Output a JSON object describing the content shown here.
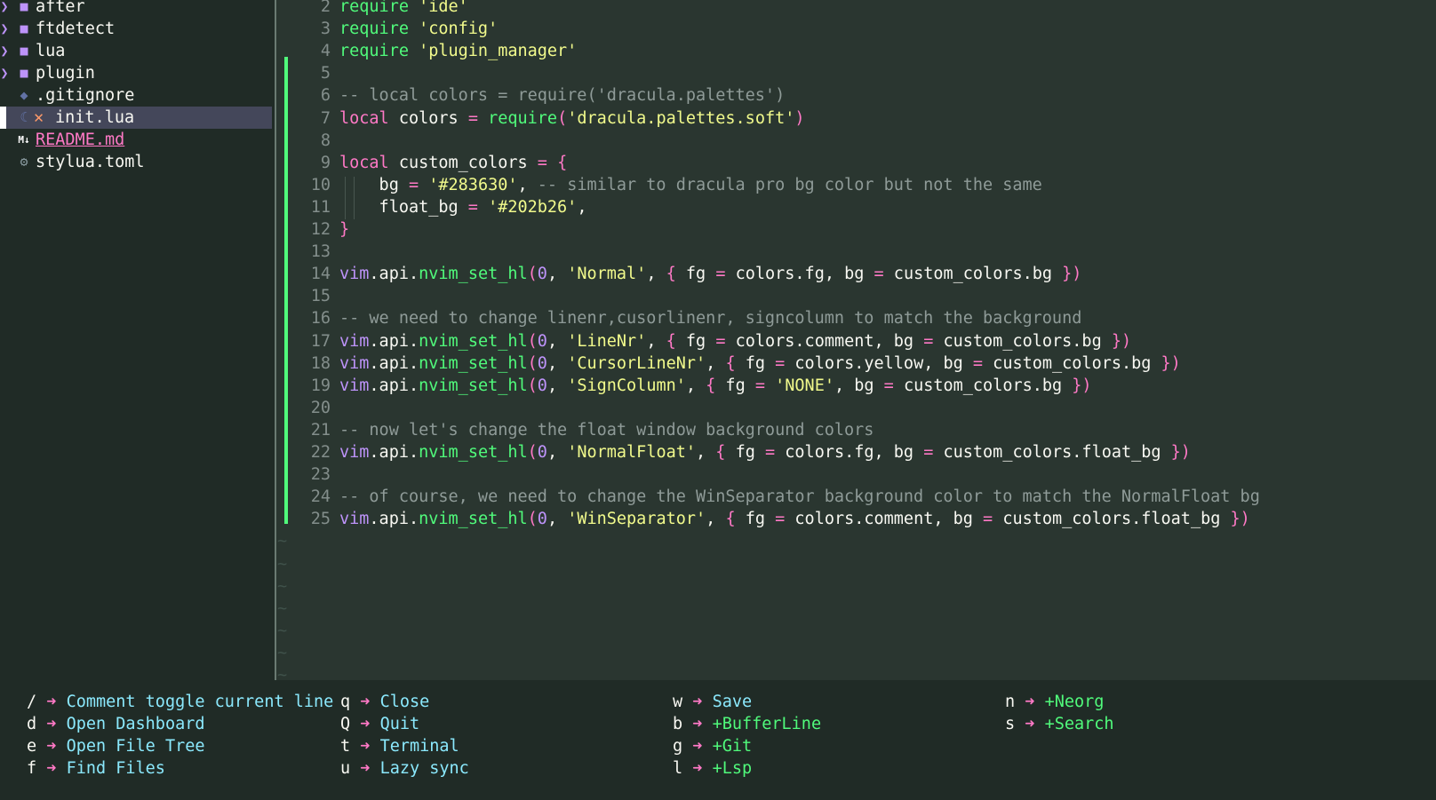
{
  "file_tree": {
    "items": [
      {
        "name": "after",
        "type": "folder",
        "expanded": false
      },
      {
        "name": "ftdetect",
        "type": "folder",
        "expanded": false
      },
      {
        "name": "lua",
        "type": "folder",
        "expanded": false
      },
      {
        "name": "plugin",
        "type": "folder",
        "expanded": false
      },
      {
        "name": ".gitignore",
        "type": "file",
        "icon": "git-icon"
      },
      {
        "name": "init.lua",
        "type": "file",
        "icon": "lua-icon",
        "active": true,
        "modified_mark": "✕"
      },
      {
        "name": "README.md",
        "type": "file",
        "icon": "markdown-icon"
      },
      {
        "name": "stylua.toml",
        "type": "file",
        "icon": "gear-icon"
      }
    ]
  },
  "editor": {
    "lines": [
      {
        "n": "2",
        "tokens": [
          [
            "fn",
            "require"
          ],
          [
            "id",
            " "
          ],
          [
            "str",
            "'ide'"
          ]
        ]
      },
      {
        "n": "3",
        "tokens": [
          [
            "fn",
            "require"
          ],
          [
            "id",
            " "
          ],
          [
            "str",
            "'config'"
          ]
        ]
      },
      {
        "n": "4",
        "tokens": [
          [
            "fn",
            "require"
          ],
          [
            "id",
            " "
          ],
          [
            "str",
            "'plugin_manager'"
          ]
        ]
      },
      {
        "n": "5",
        "tokens": []
      },
      {
        "n": "6",
        "tokens": [
          [
            "cm",
            "-- local colors = require('dracula.palettes')"
          ]
        ]
      },
      {
        "n": "7",
        "tokens": [
          [
            "kw",
            "local"
          ],
          [
            "id",
            " colors "
          ],
          [
            "kw",
            "="
          ],
          [
            "id",
            " "
          ],
          [
            "fn",
            "require"
          ],
          [
            "br",
            "("
          ],
          [
            "str",
            "'dracula.palettes.soft'"
          ],
          [
            "br",
            ")"
          ]
        ]
      },
      {
        "n": "8",
        "tokens": []
      },
      {
        "n": "9",
        "tokens": [
          [
            "kw",
            "local"
          ],
          [
            "id",
            " custom_colors "
          ],
          [
            "kw",
            "="
          ],
          [
            "id",
            " "
          ],
          [
            "br",
            "{"
          ]
        ]
      },
      {
        "n": "10",
        "tokens": [
          [
            "id",
            "    bg "
          ],
          [
            "kw",
            "="
          ],
          [
            "id",
            " "
          ],
          [
            "str",
            "'#283630'"
          ],
          [
            "id",
            ", "
          ],
          [
            "cm",
            "-- similar to dracula pro bg color but not the same"
          ]
        ]
      },
      {
        "n": "11",
        "tokens": [
          [
            "id",
            "    float_bg "
          ],
          [
            "kw",
            "="
          ],
          [
            "id",
            " "
          ],
          [
            "str",
            "'#202b26'"
          ],
          [
            "id",
            ","
          ]
        ]
      },
      {
        "n": "12",
        "tokens": [
          [
            "br",
            "}"
          ]
        ]
      },
      {
        "n": "13",
        "tokens": []
      },
      {
        "n": "14",
        "tokens": [
          [
            "vim",
            "vim"
          ],
          [
            "id",
            ".api."
          ],
          [
            "fn",
            "nvim_set_hl"
          ],
          [
            "br",
            "("
          ],
          [
            "num",
            "0"
          ],
          [
            "id",
            ", "
          ],
          [
            "str",
            "'Normal'"
          ],
          [
            "id",
            ", "
          ],
          [
            "br",
            "{"
          ],
          [
            "id",
            " fg "
          ],
          [
            "kw",
            "="
          ],
          [
            "id",
            " colors.fg, bg "
          ],
          [
            "kw",
            "="
          ],
          [
            "id",
            " custom_colors.bg "
          ],
          [
            "br",
            "})"
          ]
        ]
      },
      {
        "n": "15",
        "tokens": []
      },
      {
        "n": "16",
        "tokens": [
          [
            "cm",
            "-- we need to change linenr,cusorlinenr, signcolumn to match the background"
          ]
        ]
      },
      {
        "n": "17",
        "tokens": [
          [
            "vim",
            "vim"
          ],
          [
            "id",
            ".api."
          ],
          [
            "fn",
            "nvim_set_hl"
          ],
          [
            "br",
            "("
          ],
          [
            "num",
            "0"
          ],
          [
            "id",
            ", "
          ],
          [
            "str",
            "'LineNr'"
          ],
          [
            "id",
            ", "
          ],
          [
            "br",
            "{"
          ],
          [
            "id",
            " fg "
          ],
          [
            "kw",
            "="
          ],
          [
            "id",
            " colors.comment, bg "
          ],
          [
            "kw",
            "="
          ],
          [
            "id",
            " custom_colors.bg "
          ],
          [
            "br",
            "})"
          ]
        ]
      },
      {
        "n": "18",
        "tokens": [
          [
            "vim",
            "vim"
          ],
          [
            "id",
            ".api."
          ],
          [
            "fn",
            "nvim_set_hl"
          ],
          [
            "br",
            "("
          ],
          [
            "num",
            "0"
          ],
          [
            "id",
            ", "
          ],
          [
            "str",
            "'CursorLineNr'"
          ],
          [
            "id",
            ", "
          ],
          [
            "br",
            "{"
          ],
          [
            "id",
            " fg "
          ],
          [
            "kw",
            "="
          ],
          [
            "id",
            " colors.yellow, bg "
          ],
          [
            "kw",
            "="
          ],
          [
            "id",
            " custom_colors.bg "
          ],
          [
            "br",
            "})"
          ]
        ]
      },
      {
        "n": "19",
        "tokens": [
          [
            "vim",
            "vim"
          ],
          [
            "id",
            ".api."
          ],
          [
            "fn",
            "nvim_set_hl"
          ],
          [
            "br",
            "("
          ],
          [
            "num",
            "0"
          ],
          [
            "id",
            ", "
          ],
          [
            "str",
            "'SignColumn'"
          ],
          [
            "id",
            ", "
          ],
          [
            "br",
            "{"
          ],
          [
            "id",
            " fg "
          ],
          [
            "kw",
            "="
          ],
          [
            "id",
            " "
          ],
          [
            "str",
            "'NONE'"
          ],
          [
            "id",
            ", bg "
          ],
          [
            "kw",
            "="
          ],
          [
            "id",
            " custom_colors.bg "
          ],
          [
            "br",
            "})"
          ]
        ]
      },
      {
        "n": "20",
        "tokens": []
      },
      {
        "n": "21",
        "tokens": [
          [
            "cm",
            "-- now let's change the float window background colors"
          ]
        ]
      },
      {
        "n": "22",
        "tokens": [
          [
            "vim",
            "vim"
          ],
          [
            "id",
            ".api."
          ],
          [
            "fn",
            "nvim_set_hl"
          ],
          [
            "br",
            "("
          ],
          [
            "num",
            "0"
          ],
          [
            "id",
            ", "
          ],
          [
            "str",
            "'NormalFloat'"
          ],
          [
            "id",
            ", "
          ],
          [
            "br",
            "{"
          ],
          [
            "id",
            " fg "
          ],
          [
            "kw",
            "="
          ],
          [
            "id",
            " colors.fg, bg "
          ],
          [
            "kw",
            "="
          ],
          [
            "id",
            " custom_colors.float_bg "
          ],
          [
            "br",
            "})"
          ]
        ]
      },
      {
        "n": "23",
        "tokens": []
      },
      {
        "n": "24",
        "tokens": [
          [
            "cm",
            "-- of course, we need to change the WinSeparator background color to match the NormalFloat bg"
          ]
        ]
      },
      {
        "n": "25",
        "tokens": [
          [
            "vim",
            "vim"
          ],
          [
            "id",
            ".api."
          ],
          [
            "fn",
            "nvim_set_hl"
          ],
          [
            "br",
            "("
          ],
          [
            "num",
            "0"
          ],
          [
            "id",
            ", "
          ],
          [
            "str",
            "'WinSeparator'"
          ],
          [
            "id",
            ", "
          ],
          [
            "br",
            "{"
          ],
          [
            "id",
            " fg "
          ],
          [
            "kw",
            "="
          ],
          [
            "id",
            " colors.comment, bg "
          ],
          [
            "kw",
            "="
          ],
          [
            "id",
            " custom_colors.float_bg "
          ],
          [
            "br",
            "})"
          ]
        ]
      }
    ],
    "tilde": "~"
  },
  "which_key": {
    "arrow": "➜",
    "columns": [
      [
        {
          "key": "/",
          "desc": "Comment toggle current line",
          "group": false
        },
        {
          "key": "d",
          "desc": "Open Dashboard",
          "group": false
        },
        {
          "key": "e",
          "desc": "Open File Tree",
          "group": false
        },
        {
          "key": "f",
          "desc": "Find Files",
          "group": false
        }
      ],
      [
        {
          "key": "q",
          "desc": "Close",
          "group": false
        },
        {
          "key": "Q",
          "desc": "Quit",
          "group": false
        },
        {
          "key": "t",
          "desc": "Terminal",
          "group": false
        },
        {
          "key": "u",
          "desc": "Lazy sync",
          "group": false
        }
      ],
      [
        {
          "key": "w",
          "desc": "Save",
          "group": false
        },
        {
          "key": "b",
          "desc": "+BufferLine",
          "group": true
        },
        {
          "key": "g",
          "desc": "+Git",
          "group": true
        },
        {
          "key": "l",
          "desc": "+Lsp",
          "group": true
        }
      ],
      [
        {
          "key": "n",
          "desc": "+Neorg",
          "group": true
        },
        {
          "key": "s",
          "desc": "+Search",
          "group": true
        }
      ]
    ]
  }
}
